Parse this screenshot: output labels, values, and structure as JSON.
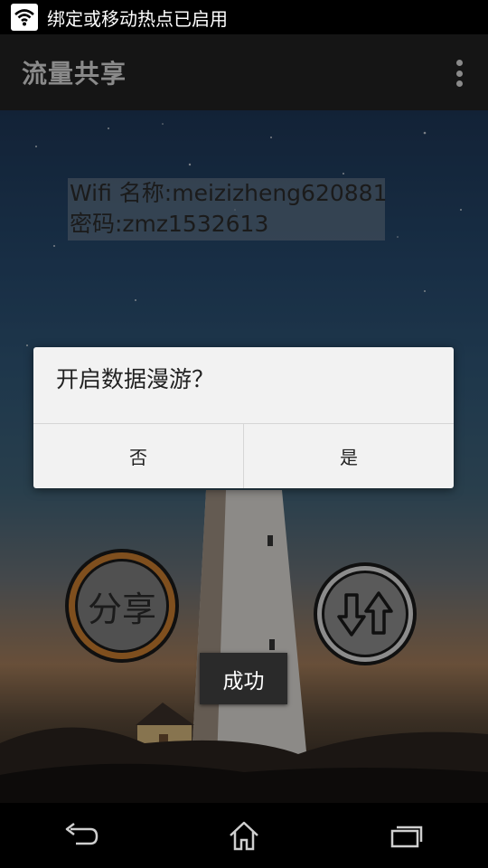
{
  "status_bar": {
    "notification_text": "绑定或移动热点已启用",
    "icon": "wifi-hotspot-icon"
  },
  "action_bar": {
    "title": "流量共享",
    "overflow_icon": "overflow-menu-icon"
  },
  "main": {
    "wifi_name_line": "Wifi 名称:meizizheng620881",
    "password_line": "密码:zmz1532613",
    "share_button_label": "分享",
    "swap_icon": "up-down-arrows-icon"
  },
  "dialog": {
    "message": "开启数据漫游？",
    "negative_label": "否",
    "positive_label": "是"
  },
  "toast": {
    "text": "成功"
  },
  "nav_bar": {
    "back_icon": "back-icon",
    "home_icon": "home-icon",
    "recents_icon": "recents-icon"
  },
  "colors": {
    "share_ring": "#c47a2e",
    "dialog_bg": "#f2f2f2",
    "action_bar_bg": "#151515"
  }
}
